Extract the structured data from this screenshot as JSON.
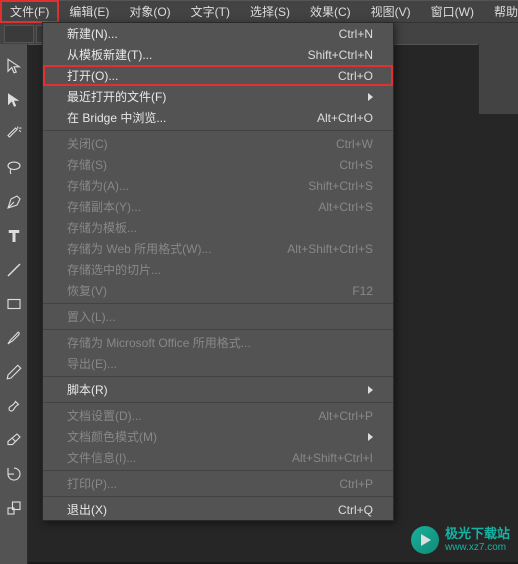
{
  "menubar": {
    "items": [
      {
        "label": "文件(F)",
        "active": true
      },
      {
        "label": "编辑(E)"
      },
      {
        "label": "对象(O)"
      },
      {
        "label": "文字(T)"
      },
      {
        "label": "选择(S)"
      },
      {
        "label": "效果(C)"
      },
      {
        "label": "视图(V)"
      },
      {
        "label": "窗口(W)"
      },
      {
        "label": "帮助"
      }
    ]
  },
  "file_menu": [
    {
      "type": "item",
      "label": "新建(N)...",
      "shortcut": "Ctrl+N"
    },
    {
      "type": "item",
      "label": "从模板新建(T)...",
      "shortcut": "Shift+Ctrl+N"
    },
    {
      "type": "item",
      "label": "打开(O)...",
      "shortcut": "Ctrl+O",
      "highlighted": true
    },
    {
      "type": "item",
      "label": "最近打开的文件(F)",
      "submenu": true
    },
    {
      "type": "item",
      "label": "在 Bridge 中浏览...",
      "shortcut": "Alt+Ctrl+O"
    },
    {
      "type": "separator"
    },
    {
      "type": "item",
      "label": "关闭(C)",
      "shortcut": "Ctrl+W",
      "disabled": true
    },
    {
      "type": "item",
      "label": "存储(S)",
      "shortcut": "Ctrl+S",
      "disabled": true
    },
    {
      "type": "item",
      "label": "存储为(A)...",
      "shortcut": "Shift+Ctrl+S",
      "disabled": true
    },
    {
      "type": "item",
      "label": "存储副本(Y)...",
      "shortcut": "Alt+Ctrl+S",
      "disabled": true
    },
    {
      "type": "item",
      "label": "存储为模板...",
      "disabled": true
    },
    {
      "type": "item",
      "label": "存储为 Web 所用格式(W)...",
      "shortcut": "Alt+Shift+Ctrl+S",
      "disabled": true
    },
    {
      "type": "item",
      "label": "存储选中的切片...",
      "disabled": true
    },
    {
      "type": "item",
      "label": "恢复(V)",
      "shortcut": "F12",
      "disabled": true
    },
    {
      "type": "separator"
    },
    {
      "type": "item",
      "label": "置入(L)...",
      "disabled": true
    },
    {
      "type": "separator"
    },
    {
      "type": "item",
      "label": "存储为 Microsoft Office 所用格式...",
      "disabled": true
    },
    {
      "type": "item",
      "label": "导出(E)...",
      "disabled": true
    },
    {
      "type": "separator"
    },
    {
      "type": "item",
      "label": "脚本(R)",
      "submenu": true
    },
    {
      "type": "separator"
    },
    {
      "type": "item",
      "label": "文档设置(D)...",
      "shortcut": "Alt+Ctrl+P",
      "disabled": true
    },
    {
      "type": "item",
      "label": "文档颜色模式(M)",
      "submenu": true,
      "disabled": true
    },
    {
      "type": "item",
      "label": "文件信息(I)...",
      "shortcut": "Alt+Shift+Ctrl+I",
      "disabled": true
    },
    {
      "type": "separator"
    },
    {
      "type": "item",
      "label": "打印(P)...",
      "shortcut": "Ctrl+P",
      "disabled": true
    },
    {
      "type": "separator"
    },
    {
      "type": "item",
      "label": "退出(X)",
      "shortcut": "Ctrl+Q"
    }
  ],
  "watermark": {
    "title": "极光下载站",
    "url": "www.xz7.com"
  }
}
